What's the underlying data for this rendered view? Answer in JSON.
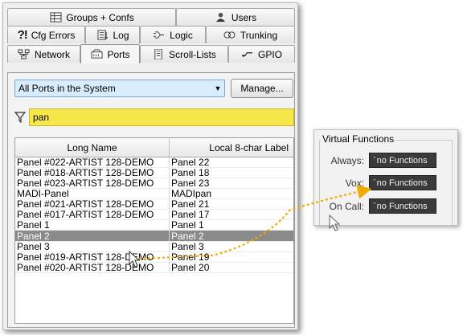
{
  "tabs": {
    "row1": [
      {
        "label": "Groups + Confs",
        "icon": "groups-icon"
      },
      {
        "label": "Users",
        "icon": "user-icon"
      }
    ],
    "row2": [
      {
        "label": "Cfg Errors",
        "icon": "error-icon",
        "mark": "?!"
      },
      {
        "label": "Log",
        "icon": "log-icon"
      },
      {
        "label": "Logic",
        "icon": "logic-icon"
      },
      {
        "label": "Trunking",
        "icon": "trunking-icon"
      }
    ],
    "row3": [
      {
        "label": "Network",
        "icon": "network-icon"
      },
      {
        "label": "Ports",
        "icon": "ports-icon",
        "active": true
      },
      {
        "label": "Scroll-Lists",
        "icon": "scroll-lists-icon"
      },
      {
        "label": "GPIO",
        "icon": "gpio-icon"
      }
    ]
  },
  "scope": {
    "selected": "All Ports in the System",
    "manage_label": "Manage..."
  },
  "filter": {
    "value": "pan",
    "icon": "filter-funnel-icon"
  },
  "table": {
    "columns": [
      "Long Name",
      "Local 8-char Label"
    ],
    "rows": [
      [
        "Panel #022-ARTIST 128-DEMO",
        "Panel 22"
      ],
      [
        "Panel #018-ARTIST 128-DEMO",
        "Panel 18"
      ],
      [
        "Panel #023-ARTIST 128-DEMO",
        "Panel 23"
      ],
      [
        "MADI-Panel",
        "MADIpan"
      ],
      [
        "Panel #021-ARTIST 128-DEMO",
        "Panel 21"
      ],
      [
        "Panel #017-ARTIST 128-DEMO",
        "Panel 17"
      ],
      [
        "Panel 1",
        "Panel 1"
      ],
      [
        "Panel 2",
        "Panel 2"
      ],
      [
        "Panel 3",
        "Panel 3"
      ],
      [
        "Panel #019-ARTIST 128-DEMO",
        "Panel 19"
      ],
      [
        "Panel #020-ARTIST 128-DEMO",
        "Panel 20"
      ]
    ],
    "selected_index": 7
  },
  "virtual_functions": {
    "title": "Virtual Functions",
    "rows": [
      {
        "label": "Always:",
        "value": "no Functions"
      },
      {
        "label": "Vox:",
        "value": "no Functions"
      },
      {
        "label": "On Call:",
        "value": "no Functions"
      }
    ]
  },
  "colors": {
    "filter_bg": "#f6e84a",
    "selection_bg": "#8a8a8a",
    "combo_bg": "#d9ecfb",
    "callout_arrow": "#f2a900"
  }
}
